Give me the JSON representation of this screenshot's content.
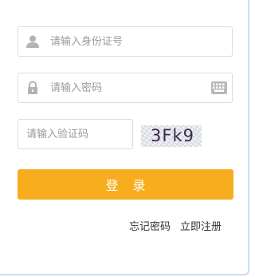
{
  "form": {
    "id_card": {
      "placeholder": "请输入身份证号",
      "icon": "user-icon"
    },
    "password": {
      "placeholder": "请输入密码",
      "icon": "lock-icon",
      "keyboard_icon": "keyboard-icon"
    },
    "captcha": {
      "placeholder": "请输入验证码",
      "code": "3Fk9"
    },
    "login_label": "登录",
    "forgot_password": "忘记密码",
    "register": "立即注册"
  },
  "colors": {
    "primary": "#f7ad1d",
    "border": "#dcdcdc",
    "icon": "#b3b3b3",
    "panel_edge": "#c9def0"
  }
}
